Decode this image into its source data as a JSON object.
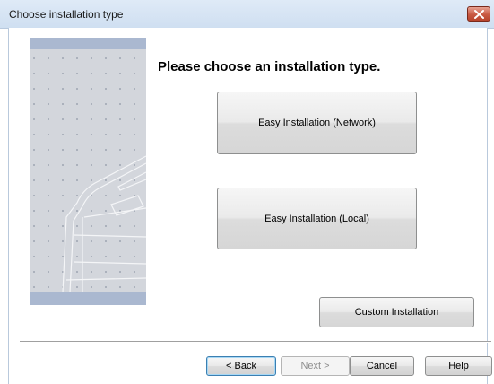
{
  "window": {
    "title": "Choose installation type"
  },
  "main": {
    "heading": "Please choose an installation type.",
    "options": [
      {
        "label": "Easy Installation (Network)"
      },
      {
        "label": "Easy Installation (Local)"
      },
      {
        "label": "Custom Installation"
      }
    ]
  },
  "footer": {
    "back_label": "< Back",
    "next_label": "Next >",
    "cancel_label": "Cancel",
    "help_label": "Help"
  },
  "icons": {
    "close": "close-icon",
    "banner": "printer-illustration"
  },
  "colors": {
    "titlebar": "#cfdff1",
    "close_button": "#c85a43",
    "banner_background": "#d3d6dc",
    "banner_stripe": "#aab8d0"
  }
}
